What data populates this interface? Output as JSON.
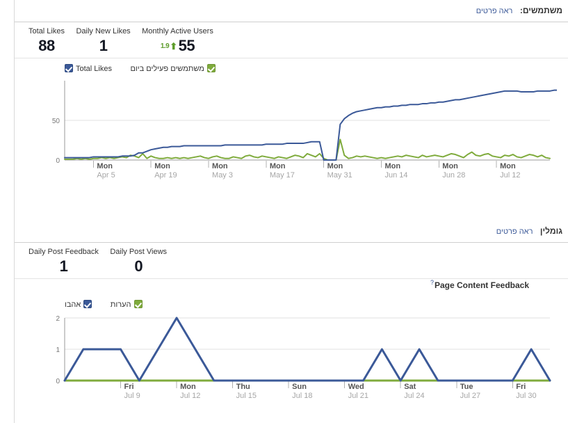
{
  "colors": {
    "series_blue": "#3b5998",
    "series_green": "#7fab3c",
    "link_blue": "#3b5998",
    "positive_green": "#5d9c2b",
    "axis_text": "#999999",
    "grid": "#e2e2e2"
  },
  "users_section": {
    "title": "משתמשים:",
    "details_link": "ראה פרטים",
    "metrics": [
      {
        "label": "Total Likes",
        "value": "88"
      },
      {
        "label": "Daily New Likes",
        "value": "1"
      },
      {
        "label": "Monthly Active Users",
        "value": "55",
        "delta": "1.9",
        "delta_arrow": "⬆"
      }
    ],
    "legend": [
      {
        "label": "Total Likes",
        "color": "blue",
        "checked": true
      },
      {
        "label": "משתמשים פעילים ביום",
        "color": "green",
        "checked": true
      }
    ]
  },
  "engagement_section": {
    "title": "גומלין",
    "details_link": "ראה פרטים",
    "metrics": [
      {
        "label": "Daily Post Feedback",
        "value": "1"
      },
      {
        "label": "Daily Post Views",
        "value": "0"
      }
    ],
    "subtitle": "Page Content Feedback",
    "help_icon": "?",
    "legend": [
      {
        "label": "אהבו",
        "color": "blue",
        "checked": true
      },
      {
        "label": "הערות",
        "color": "green",
        "checked": true
      }
    ]
  },
  "chart_data": [
    {
      "id": "users-chart",
      "type": "line",
      "title": "",
      "xlabel": "",
      "ylabel": "",
      "ylim": [
        0,
        100
      ],
      "yticks": [
        0,
        50
      ],
      "ytick_labels": [
        "0",
        "50"
      ],
      "grid": true,
      "legend": [
        "Total Likes",
        "משתמשים פעילים ביום"
      ],
      "legend_position": "top-left",
      "xtick_labels": [
        {
          "day": "Mon",
          "date": "Apr 5"
        },
        {
          "day": "Mon",
          "date": "Apr 19"
        },
        {
          "day": "Mon",
          "date": "May 3"
        },
        {
          "day": "Mon",
          "date": "May 17"
        },
        {
          "day": "Mon",
          "date": "May 31"
        },
        {
          "day": "Mon",
          "date": "Jun 14"
        },
        {
          "day": "Mon",
          "date": "Jun 28"
        },
        {
          "day": "Mon",
          "date": "Jul 12"
        }
      ],
      "xtick_index": [
        7,
        21,
        35,
        49,
        63,
        77,
        91,
        105
      ],
      "n_points": 119,
      "series": [
        {
          "name": "Total Likes",
          "color": "#3b5998",
          "values": [
            3,
            3,
            3,
            3,
            3,
            3,
            3,
            4,
            4,
            4,
            4,
            4,
            4,
            4,
            5,
            5,
            5,
            6,
            9,
            9,
            11,
            13,
            14,
            15,
            16,
            16,
            17,
            17,
            17,
            18,
            18,
            18,
            18,
            18,
            18,
            18,
            18,
            18,
            18,
            19,
            19,
            19,
            19,
            19,
            19,
            19,
            19,
            19,
            19,
            20,
            20,
            20,
            20,
            20,
            21,
            21,
            21,
            21,
            21,
            22,
            23,
            23,
            23,
            0,
            0,
            0,
            0,
            45,
            52,
            56,
            59,
            61,
            62,
            63,
            64,
            65,
            66,
            66,
            67,
            67,
            68,
            68,
            69,
            69,
            70,
            70,
            70,
            71,
            71,
            72,
            72,
            73,
            73,
            74,
            75,
            76,
            76,
            77,
            78,
            79,
            80,
            81,
            82,
            83,
            84,
            85,
            86,
            87,
            87,
            87,
            87,
            86,
            86,
            86,
            86,
            87,
            87,
            87,
            87,
            88,
            88,
            88,
            88
          ]
        },
        {
          "name": "משתמשים פעילים ביום",
          "color": "#7fab3c",
          "values": [
            1,
            1,
            1,
            2,
            1,
            2,
            1,
            2,
            2,
            3,
            2,
            3,
            2,
            3,
            4,
            3,
            6,
            5,
            3,
            8,
            2,
            5,
            3,
            2,
            2,
            3,
            2,
            3,
            2,
            3,
            2,
            3,
            4,
            5,
            3,
            2,
            4,
            5,
            3,
            2,
            2,
            4,
            3,
            2,
            5,
            6,
            4,
            3,
            5,
            4,
            3,
            2,
            4,
            3,
            2,
            4,
            6,
            5,
            3,
            8,
            6,
            4,
            8,
            2,
            0,
            0,
            0,
            26,
            6,
            2,
            3,
            5,
            4,
            5,
            4,
            3,
            2,
            3,
            2,
            3,
            4,
            5,
            4,
            6,
            5,
            4,
            3,
            6,
            4,
            5,
            6,
            5,
            4,
            6,
            8,
            7,
            5,
            3,
            7,
            10,
            6,
            5,
            7,
            8,
            5,
            4,
            3,
            6,
            5,
            7,
            4,
            3,
            5,
            7,
            6,
            4,
            6,
            3,
            2
          ]
        }
      ]
    },
    {
      "id": "feedback-chart",
      "type": "line",
      "title": "Page Content Feedback",
      "xlabel": "",
      "ylabel": "",
      "ylim": [
        0,
        2
      ],
      "yticks": [
        0,
        1,
        2
      ],
      "ytick_labels": [
        "0",
        "1",
        "2"
      ],
      "grid": true,
      "legend": [
        "אהבו",
        "הערות"
      ],
      "legend_position": "top-left",
      "xtick_labels": [
        {
          "day": "Fri",
          "date": "Jul 9"
        },
        {
          "day": "Mon",
          "date": "Jul 12"
        },
        {
          "day": "Thu",
          "date": "Jul 15"
        },
        {
          "day": "Sun",
          "date": "Jul 18"
        },
        {
          "day": "Wed",
          "date": "Jul 21"
        },
        {
          "day": "Sat",
          "date": "Jul 24"
        },
        {
          "day": "Tue",
          "date": "Jul 27"
        },
        {
          "day": "Fri",
          "date": "Jul 30"
        }
      ],
      "xtick_index": [
        3,
        6,
        9,
        12,
        15,
        18,
        21,
        24
      ],
      "n_points": 27,
      "series": [
        {
          "name": "אהבו",
          "color": "#3b5998",
          "values": [
            0,
            1,
            1,
            1,
            0,
            1,
            2,
            1,
            0,
            0,
            0,
            0,
            0,
            0,
            0,
            0,
            0,
            1,
            0,
            1,
            0,
            0,
            0,
            0,
            0,
            1,
            0
          ]
        },
        {
          "name": "הערות",
          "color": "#7fab3c",
          "values": [
            0,
            0,
            0,
            0,
            0,
            0,
            0,
            0,
            0,
            0,
            0,
            0,
            0,
            0,
            0,
            0,
            0,
            0,
            0,
            0,
            0,
            0,
            0,
            0,
            0,
            0,
            0
          ]
        }
      ]
    }
  ]
}
